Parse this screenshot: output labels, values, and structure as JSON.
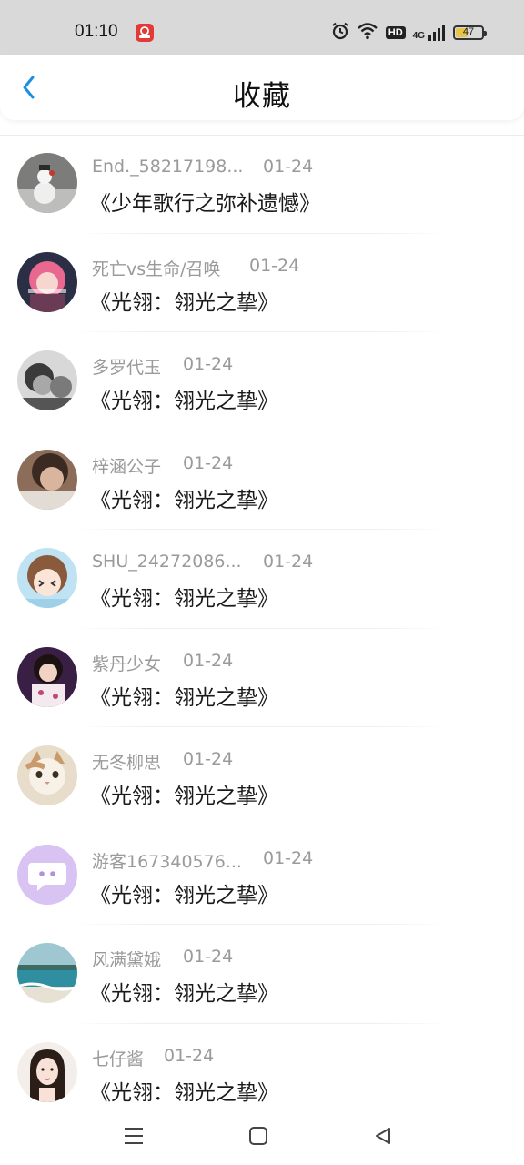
{
  "status_bar": {
    "time": "01:10",
    "battery_level": "47",
    "network_label": "4G",
    "hd_label": "HD"
  },
  "header": {
    "title": "收藏",
    "back_icon": "chevron-left-icon",
    "accent_color": "#1a8fe3"
  },
  "favorites": [
    {
      "username": "End._58217198...",
      "date": "01-24",
      "title": "《少年歌行之弥补遗憾》",
      "avatar_icon": "snowman-photo"
    },
    {
      "username": "死亡vs生命/召唤",
      "date": "01-24",
      "title": "《光翎：翎光之挚》",
      "avatar_icon": "anime-pink-hair"
    },
    {
      "username": "多罗代玉",
      "date": "01-24",
      "title": "《光翎：翎光之挚》",
      "avatar_icon": "bw-photo"
    },
    {
      "username": "梓涵公子",
      "date": "01-24",
      "title": "《光翎：翎光之挚》",
      "avatar_icon": "person-photo"
    },
    {
      "username": "SHU_24272086...",
      "date": "01-24",
      "title": "《光翎：翎光之挚》",
      "avatar_icon": "anime-girl"
    },
    {
      "username": "紫丹少女",
      "date": "01-24",
      "title": "《光翎：翎光之挚》",
      "avatar_icon": "girl-photo"
    },
    {
      "username": "无冬柳思",
      "date": "01-24",
      "title": "《光翎：翎光之挚》",
      "avatar_icon": "cat-photo"
    },
    {
      "username": "游客167340576...",
      "date": "01-24",
      "title": "《光翎：翎光之挚》",
      "avatar_icon": "chat-bubble-avatar"
    },
    {
      "username": "风满黛娥",
      "date": "01-24",
      "title": "《光翎：翎光之挚》",
      "avatar_icon": "seascape-photo"
    },
    {
      "username": "七仔酱",
      "date": "01-24",
      "title": "《光翎：翎光之挚》",
      "avatar_icon": "drawn-girl"
    }
  ],
  "nav_bar": {
    "menu_icon": "menu-icon",
    "home_icon": "square-home-icon",
    "back_icon": "triangle-back-icon"
  }
}
